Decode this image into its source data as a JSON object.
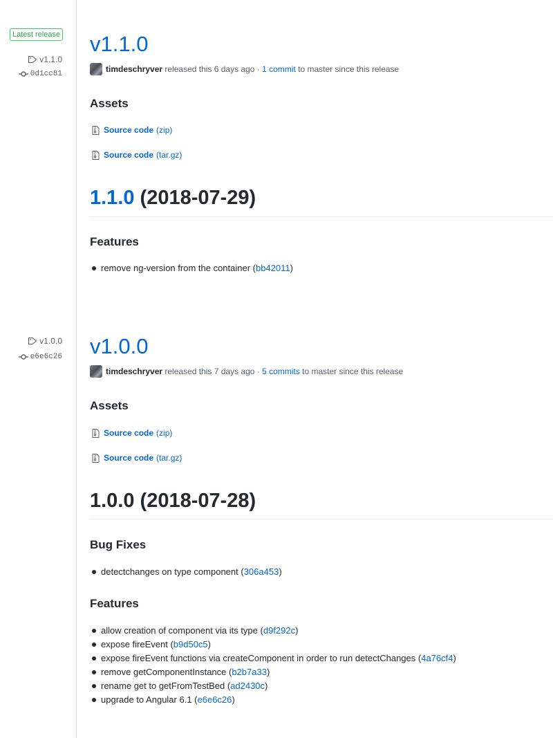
{
  "colors": {
    "link": "#0366d6",
    "text": "#24292e",
    "muted": "#586069",
    "latest_badge": "#28a745",
    "divider": "#e1e4e8"
  },
  "releases": [
    {
      "latest_badge": "Latest release",
      "tag": "v1.1.0",
      "commit_sha": "0d1cc81",
      "title": "v1.1.0",
      "author": "timdeschryver",
      "released_text": " released this 6 days ago · ",
      "commits_link": "1 commit",
      "since_text": " to master since this release",
      "assets_heading": "Assets",
      "assets": [
        {
          "label": "Source code",
          "ext": "(zip)"
        },
        {
          "label": "Source code",
          "ext": "(tar.gz)"
        }
      ],
      "changelog_version_link": "1.1.0",
      "changelog_date": " (2018-07-29)",
      "sections": [
        {
          "heading": "Features",
          "items": [
            {
              "text": "remove ng-version from the container (",
              "hash": "bb42011",
              "close": ")"
            }
          ]
        }
      ]
    },
    {
      "tag": "v1.0.0",
      "commit_sha": "e6e6c26",
      "title": "v1.0.0",
      "author": "timdeschryver",
      "released_text": " released this 7 days ago · ",
      "commits_link": "5 commits",
      "since_text": " to master since this release",
      "assets_heading": "Assets",
      "assets": [
        {
          "label": "Source code",
          "ext": "(zip)"
        },
        {
          "label": "Source code",
          "ext": "(tar.gz)"
        }
      ],
      "changelog_heading": "1.0.0 (2018-07-28)",
      "sections": [
        {
          "heading": "Bug Fixes",
          "items": [
            {
              "text": "detectchanges on type component (",
              "hash": "306a453",
              "close": ")"
            }
          ]
        },
        {
          "heading": "Features",
          "items": [
            {
              "text": "allow creation of component via its type (",
              "hash": "d9f292c",
              "close": ")"
            },
            {
              "text": "expose fireEvent (",
              "hash": "b9d50c5",
              "close": ")"
            },
            {
              "text": "expose fireEvent functions via createComponent in order to run detectChanges (",
              "hash": "4a76cf4",
              "close": ")"
            },
            {
              "text": "remove getComponentInstance (",
              "hash": "b2b7a33",
              "close": ")"
            },
            {
              "text": "rename get to getFromTestBed (",
              "hash": "ad2430c",
              "close": ")"
            },
            {
              "text": "upgrade to Angular 6.1 (",
              "hash": "e6e6c26",
              "close": ")"
            }
          ]
        }
      ]
    }
  ]
}
